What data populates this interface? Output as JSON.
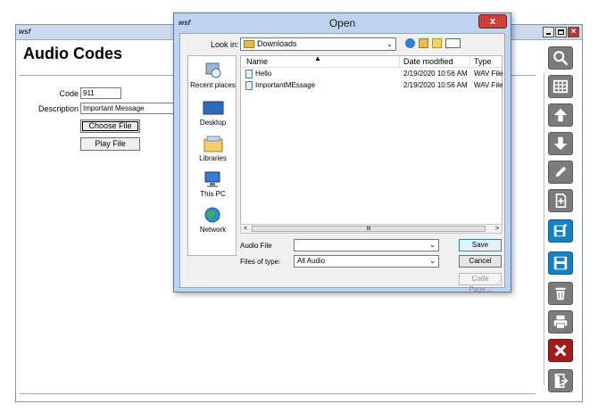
{
  "app": {
    "logo": "wsf",
    "title": "Audio Codes",
    "form": {
      "code_label": "Code",
      "code_value": "911",
      "description_label": "Description",
      "description_value": "Important Message",
      "choose_file_label": "Choose File",
      "play_file_label": "Play File"
    },
    "toolbar": [
      "search-icon",
      "grid-icon",
      "arrow-up-icon",
      "arrow-down-icon",
      "pencil-icon",
      "new-document-icon",
      "save-new-icon",
      "save-icon",
      "delete-icon",
      "print-icon",
      "close-icon",
      "exit-icon"
    ]
  },
  "dialog": {
    "logo": "wsf",
    "title": "Open",
    "close_label": "x",
    "look_in_label": "Look in:",
    "look_in_value": "Downloads",
    "places": [
      {
        "label": "Recent places",
        "icon": "recent-places-icon"
      },
      {
        "label": "Desktop",
        "icon": "desktop-icon"
      },
      {
        "label": "Libraries",
        "icon": "libraries-icon"
      },
      {
        "label": "This PC",
        "icon": "this-pc-icon"
      },
      {
        "label": "Network",
        "icon": "network-icon"
      }
    ],
    "columns": {
      "name": "Name",
      "date": "Date modified",
      "type": "Type"
    },
    "files": [
      {
        "name": "Hello",
        "date": "2/19/2020 10:56 AM",
        "type": "WAV File"
      },
      {
        "name": "ImportantMEssage",
        "date": "2/19/2020 10:56 AM",
        "type": "WAV File"
      }
    ],
    "scroll_mid": "III",
    "file_name_label": "Audio File",
    "file_name_value": "",
    "file_type_label": "Files of type:",
    "file_type_value": "All Audio",
    "save_label": "Save",
    "cancel_label": "Cancel",
    "code_page_label": "Code Page..."
  },
  "colors": {
    "accent_blue": "#1781c4",
    "toolbar_gray": "#7b7b7b",
    "close_red": "#a21b1b",
    "dialog_frame": "#bdd3ee"
  }
}
